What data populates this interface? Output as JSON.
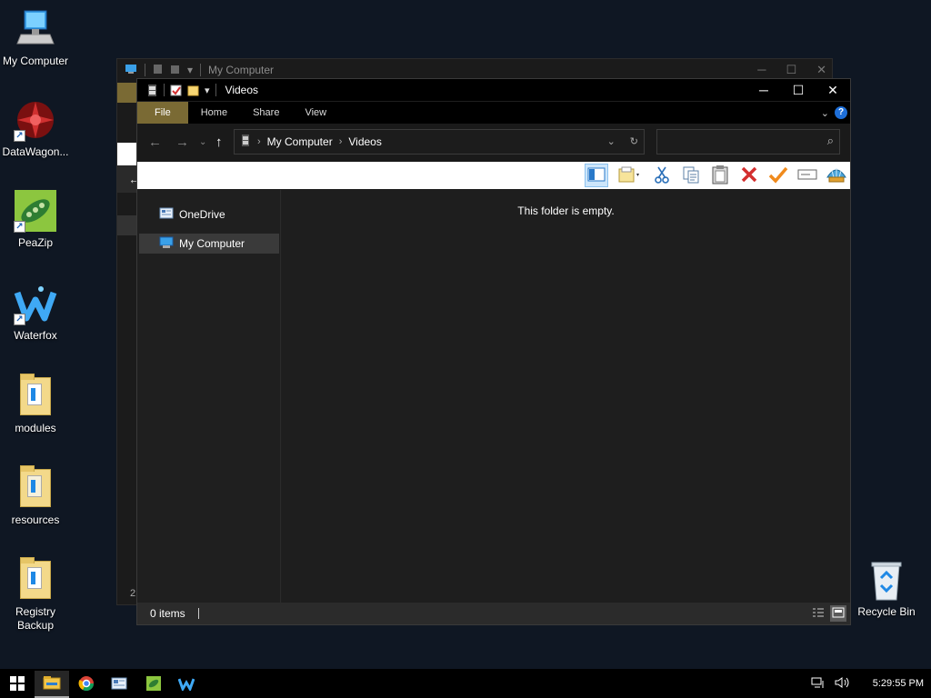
{
  "desktop": {
    "icons": [
      {
        "label": "My Computer"
      },
      {
        "label": "DataWagon..."
      },
      {
        "label": "PeaZip"
      },
      {
        "label": "Waterfox"
      },
      {
        "label": "modules"
      },
      {
        "label": "resources"
      },
      {
        "label": "Registry Backup"
      },
      {
        "label": "Recycle Bin"
      }
    ]
  },
  "bg_window": {
    "title": "My Computer",
    "footer": "2"
  },
  "window": {
    "title": "Videos",
    "ribbon_tabs": [
      "File",
      "Home",
      "Share",
      "View"
    ],
    "help": "?",
    "address": {
      "crumbs": [
        "My Computer",
        "Videos"
      ]
    },
    "search": {
      "placeholder": ""
    },
    "nav_items": [
      {
        "label": "OneDrive"
      },
      {
        "label": "My Computer"
      }
    ],
    "empty_message": "This folder is empty.",
    "status": {
      "items_count": "0 items"
    }
  },
  "taskbar": {
    "clock": "5:29:55 PM"
  },
  "colors": {
    "accent_file_tab": "#7a6a34",
    "desktop_bg": "#0f1723",
    "window_bg": "#1f1f1f"
  }
}
